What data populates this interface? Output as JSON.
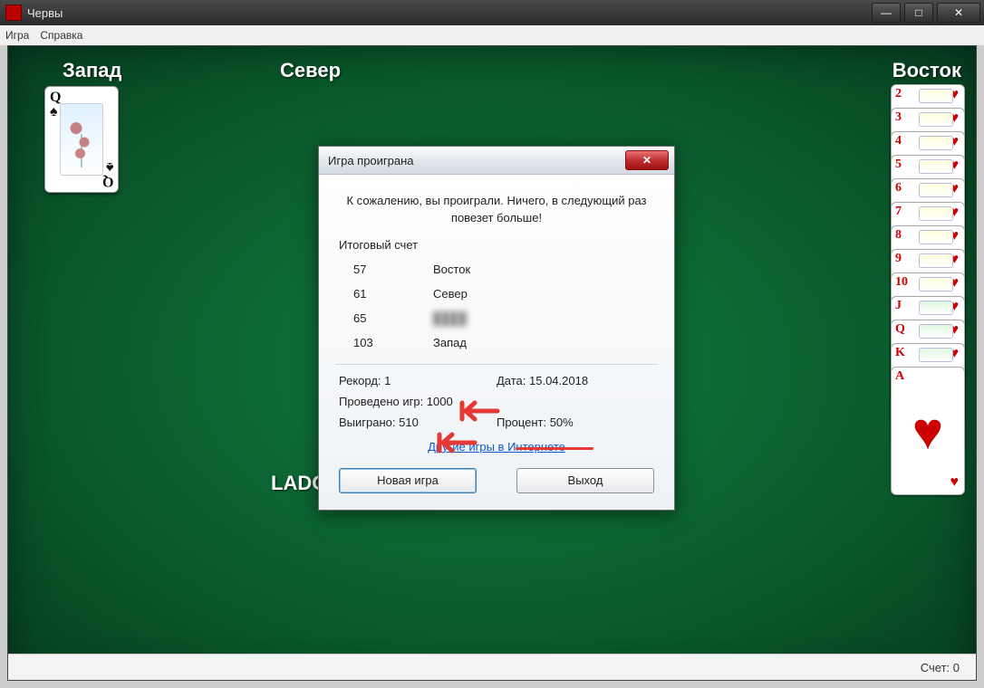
{
  "window": {
    "title": "Червы",
    "menu": {
      "game": "Игра",
      "help": "Справка"
    },
    "buttons": {
      "min": "—",
      "max": "□",
      "close": "✕"
    }
  },
  "players": {
    "west": "Запад",
    "north": "Север",
    "east": "Восток",
    "south": "LADO"
  },
  "west_card": {
    "rank": "Q",
    "suit": "♠"
  },
  "east_stack": [
    {
      "rank": "2",
      "suit": "♥",
      "face": false
    },
    {
      "rank": "3",
      "suit": "♥",
      "face": false
    },
    {
      "rank": "4",
      "suit": "♥",
      "face": false
    },
    {
      "rank": "5",
      "suit": "♥",
      "face": false
    },
    {
      "rank": "6",
      "suit": "♥",
      "face": false
    },
    {
      "rank": "7",
      "suit": "♥",
      "face": false
    },
    {
      "rank": "8",
      "suit": "♥",
      "face": false
    },
    {
      "rank": "9",
      "suit": "♥",
      "face": false
    },
    {
      "rank": "10",
      "suit": "♥",
      "face": false
    },
    {
      "rank": "J",
      "suit": "♥",
      "face": true
    },
    {
      "rank": "Q",
      "suit": "♥",
      "face": true
    },
    {
      "rank": "K",
      "suit": "♥",
      "face": true
    },
    {
      "rank": "A",
      "suit": "♥",
      "face": false,
      "ace": true
    }
  ],
  "statusbar": {
    "score_label": "Счет:",
    "score_value": "0"
  },
  "dialog": {
    "title": "Игра проиграна",
    "message": "К сожалению, вы проиграли. Ничего, в следующий раз повезет больше!",
    "final_score_label": "Итоговый счет",
    "scores": [
      {
        "score": "57",
        "name": "Восток"
      },
      {
        "score": "61",
        "name": "Север"
      },
      {
        "score": "65",
        "name": "",
        "blurred": true
      },
      {
        "score": "103",
        "name": "Запад"
      }
    ],
    "stats": {
      "record": "Рекорд: 1",
      "date": "Дата: 15.04.2018",
      "games_played": "Проведено игр: 1000",
      "won": "Выиграно: 510",
      "percent": "Процент: 50%"
    },
    "link": "Другие игры в Интернете",
    "buttons": {
      "new_game": "Новая игра",
      "exit": "Выход"
    },
    "close_glyph": "✕"
  }
}
